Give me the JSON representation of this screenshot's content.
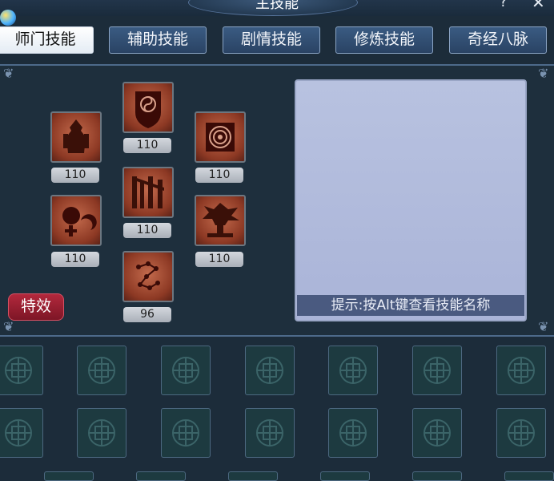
{
  "window": {
    "title": "主技能"
  },
  "tabs": [
    {
      "label": "师门技能",
      "active": true
    },
    {
      "label": "辅助技能",
      "active": false
    },
    {
      "label": "剧情技能",
      "active": false
    },
    {
      "label": "修炼技能",
      "active": false
    },
    {
      "label": "奇经八脉",
      "active": false
    }
  ],
  "skills": [
    {
      "icon": "armored-warrior-icon",
      "level": "110"
    },
    {
      "icon": "taiji-shield-icon",
      "level": "110"
    },
    {
      "icon": "spiral-seal-icon",
      "level": "110"
    },
    {
      "icon": "stone-pillars-icon",
      "level": "110"
    },
    {
      "icon": "crescent-orb-icon",
      "level": "110"
    },
    {
      "icon": "tree-spirit-icon",
      "level": "110"
    },
    {
      "icon": "constellation-icon",
      "level": "96"
    }
  ],
  "buttons": {
    "effects": "特效"
  },
  "description": {
    "hint": "提示:按Alt键查看技能名称"
  },
  "colors": {
    "effects_button": "#9b1f31",
    "skill_icon": "#b35a3e",
    "hint_bar": "#4a5a80",
    "desc_panel": "#b0bade"
  },
  "slots_icon": "ornamental-knot-icon"
}
